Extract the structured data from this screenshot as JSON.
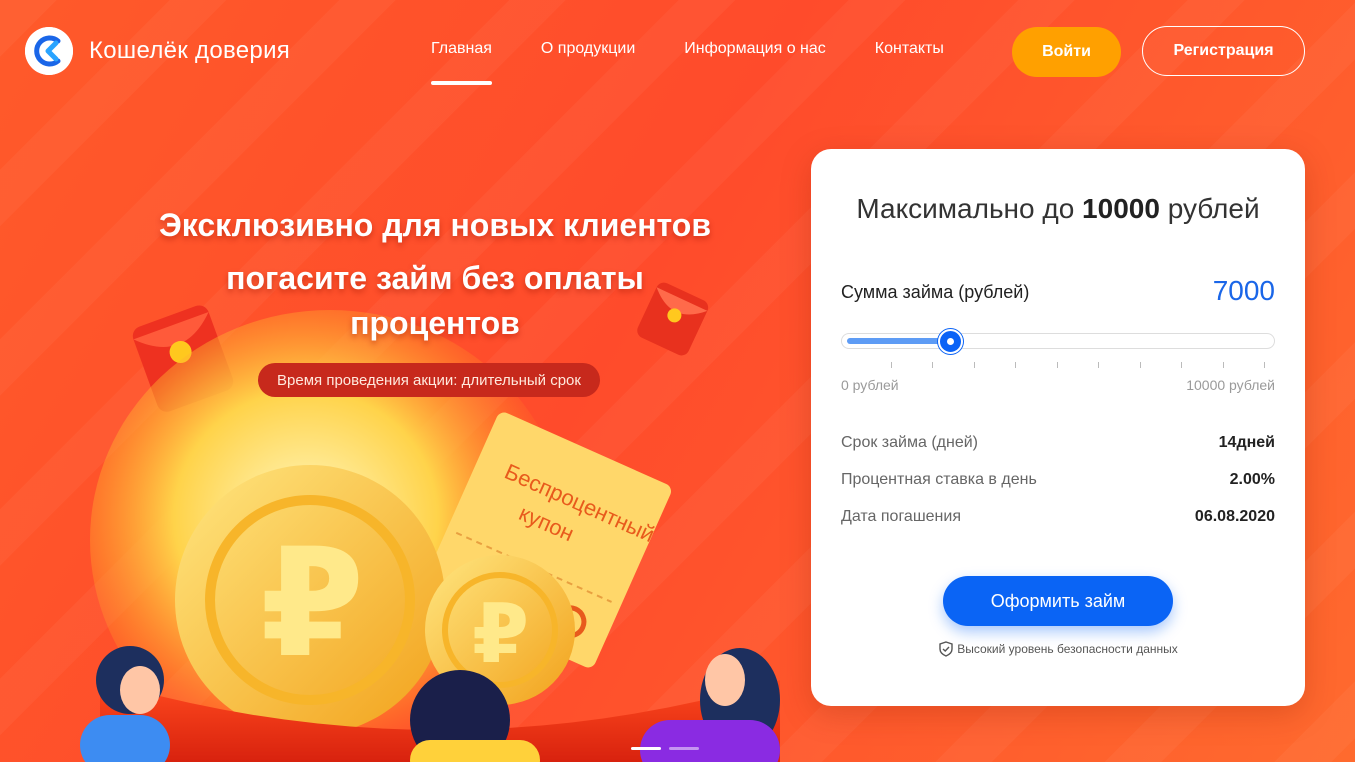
{
  "brand": {
    "name": "Кошелёк доверия",
    "logo_icon": "wallet-logo-icon",
    "color": "#1a66e8"
  },
  "nav": {
    "items": [
      {
        "label": "Главная",
        "active": true
      },
      {
        "label": "О продукции",
        "active": false
      },
      {
        "label": "Информация о нас",
        "active": false
      },
      {
        "label": "Контакты",
        "active": false
      }
    ]
  },
  "auth": {
    "login_label": "Войти",
    "register_label": "Регистрация"
  },
  "hero": {
    "title_line1": "Эксклюзивно для новых клиентов",
    "title_line2": "погасите займ без оплаты",
    "title_line3": "процентов",
    "promo": "Время проведения акции: длительный срок",
    "coupon_text_1": "Беспроцентный",
    "coupon_text_2": "купон",
    "carousel": {
      "slides": 2,
      "active": 1
    }
  },
  "calculator": {
    "title_prefix": "Максимально до",
    "title_amount": "10000",
    "title_suffix": "рублей",
    "amount_label": "Сумма займа (рублей)",
    "amount_value": "7000",
    "slider": {
      "min": 0,
      "max": 10000,
      "fill_fraction": 0.25
    },
    "range_min_label": "0 рублей",
    "range_max_label": "10000 рублей",
    "rows": [
      {
        "label": "Срок займа (дней)",
        "value": "14дней"
      },
      {
        "label": "Процентная ставка в день",
        "value": "2.00%"
      },
      {
        "label": "Дата погашения",
        "value": "06.08.2020"
      }
    ],
    "apply_label": "Оформить займ",
    "security_icon": "shield-icon",
    "security_text": "Высокий уровень безопасности данных"
  },
  "colors": {
    "accent": "#0a64f5",
    "login_bg": "#ffa000",
    "background": "#ff5a2a"
  }
}
